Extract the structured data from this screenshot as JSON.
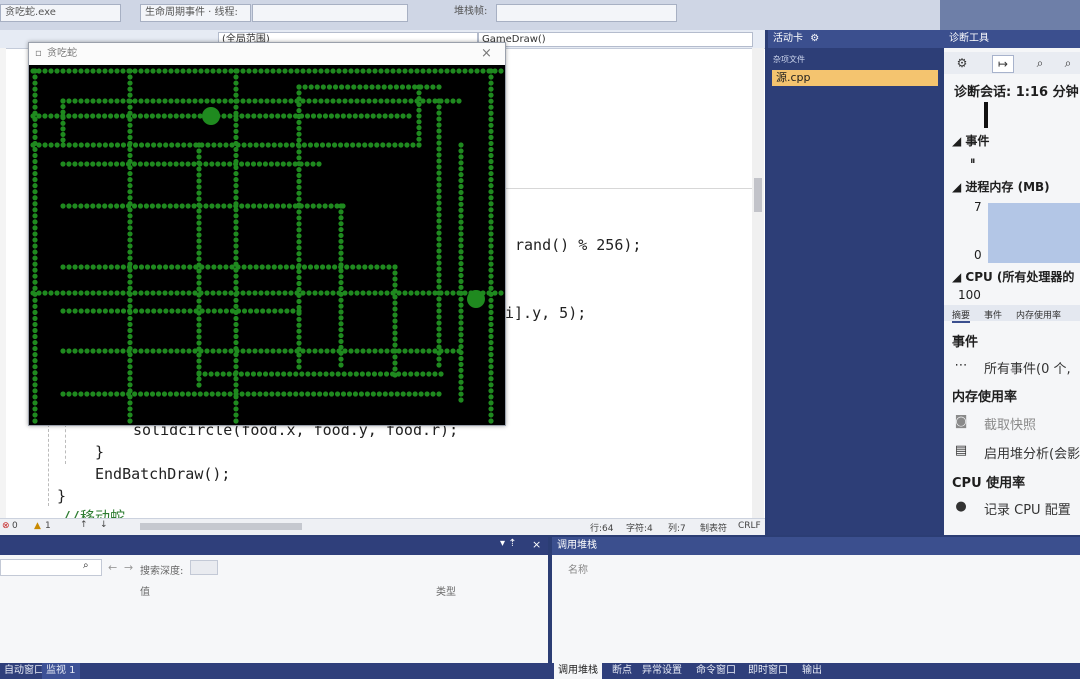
{
  "toolbar": {
    "exe_label": "贪吃蛇.exe",
    "event_filter": "生命周期事件 · 线程:",
    "stack_frame": "堆栈帧:"
  },
  "editor": {
    "scope_dropdown": "(全局范围)",
    "function_dropdown": "GameDraw()",
    "code_lines": {
      "l1": "rand() % 256);",
      "l2": "i].y, 5);",
      "l3": "solidcircle(food.x, food.y, food.r);",
      "l4": "}",
      "l5": "EndBatchDraw();",
      "l6": "}",
      "l7": "//移动蛇"
    },
    "status": {
      "errors": "0",
      "warnings": "1",
      "line": "行:64",
      "char": "字符:4",
      "col": "列:7",
      "tabs": "制表符",
      "eol": "CRLF"
    }
  },
  "game_window": {
    "title": "贪吃蛇",
    "close": "×"
  },
  "tabs_panel": {
    "title": "活动卡",
    "subtitle": "杂项文件",
    "file": "源.cpp"
  },
  "diagnostics": {
    "title": "诊断工具",
    "session": "诊断会话: 1:16 分钟",
    "events_section": "事件",
    "memory_section": "进程内存 (MB)",
    "mem_max": "7",
    "mem_min": "0",
    "cpu_section": "CPU (所有处理器的",
    "cpu_max": "100",
    "tabs": [
      "摘要",
      "事件",
      "内存使用率"
    ],
    "summary_events": "事件",
    "all_events": "所有事件(0 个,",
    "memory_usage": "内存使用率",
    "snapshot": "截取快照",
    "heap_analysis": "启用堆分析(会影",
    "cpu_usage": "CPU 使用率",
    "record_cpu": "记录 CPU 配置"
  },
  "bottom_left": {
    "search_label": "搜索深度:",
    "col_name": "值",
    "col_type": "类型"
  },
  "bottom_right": {
    "title": "调用堆栈",
    "col_name": "名称"
  },
  "bottom_tabs": {
    "left": [
      "自动窗口",
      "监视 1"
    ],
    "right": [
      "调用堆栈",
      "断点",
      "异常设置",
      "命令窗口",
      "即时窗口",
      "输出"
    ]
  },
  "colors": {
    "game_grid": "#1f8a1f",
    "game_bg": "#000000",
    "accent": "#f4c46f"
  }
}
